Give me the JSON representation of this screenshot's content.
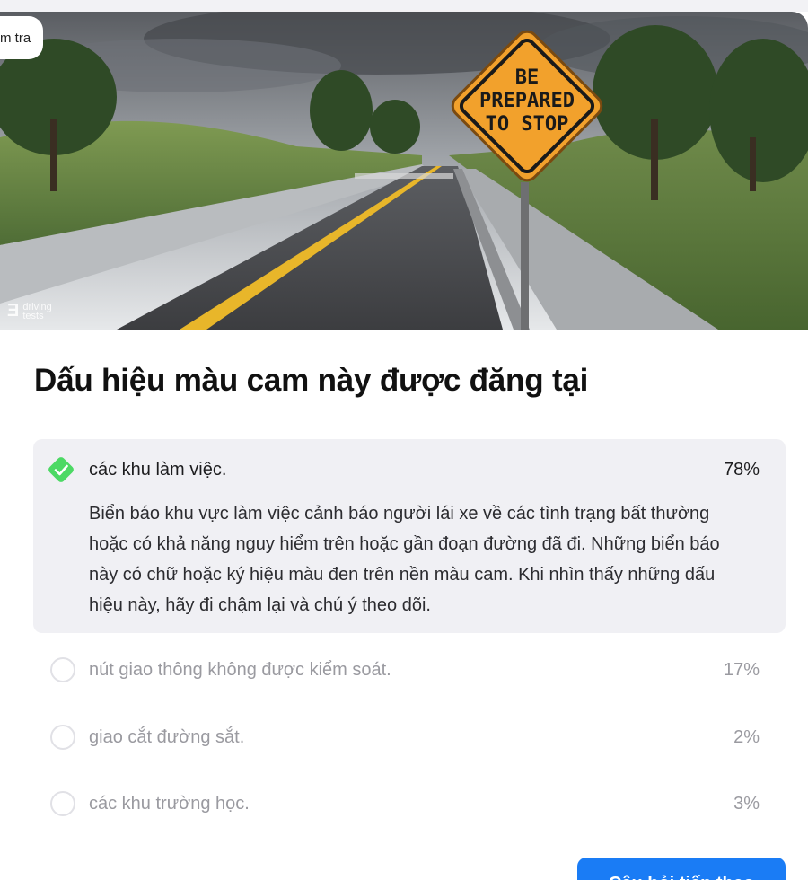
{
  "hero": {
    "tag_label": "m tra",
    "sign_text": [
      "BE",
      "PREPARED",
      "TO STOP"
    ],
    "watermark_icon": "dt-logo-icon",
    "watermark_text": "driving tests"
  },
  "question": {
    "title": "Dấu hiệu màu cam này được đăng tại"
  },
  "answers": [
    {
      "label": "các khu làm việc.",
      "percent": "78%",
      "correct": true,
      "explanation": "Biển báo khu vực làm việc cảnh báo người lái xe về các tình trạng bất thường hoặc có khả năng nguy hiểm trên hoặc gần đoạn đường đã đi. Những biển báo này có chữ hoặc ký hiệu màu đen trên nền màu cam. Khi nhìn thấy những dấu hiệu này, hãy đi chậm lại và chú ý theo dõi."
    },
    {
      "label": "nút giao thông không được kiểm soát.",
      "percent": "17%",
      "correct": false
    },
    {
      "label": "giao cắt đường sắt.",
      "percent": "2%",
      "correct": false
    },
    {
      "label": "các khu trường học.",
      "percent": "3%",
      "correct": false
    }
  ],
  "next_button": {
    "label": "Câu hỏi tiếp theo"
  },
  "colors": {
    "correct_green": "#4cd964",
    "button_blue": "#1a7cf5",
    "sign_orange": "#f2a12c"
  }
}
